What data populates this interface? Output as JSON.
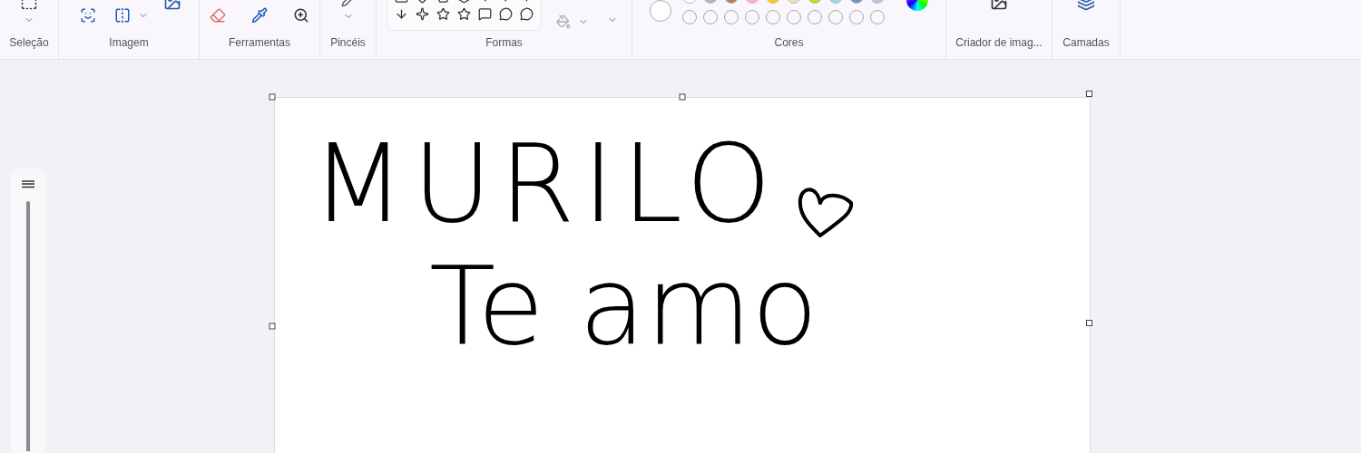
{
  "ribbon": {
    "groups": [
      {
        "kind": "selection",
        "label": "Seleção"
      },
      {
        "kind": "image",
        "label": "Imagem"
      },
      {
        "kind": "tools",
        "label": "Ferramentas"
      },
      {
        "kind": "brushes",
        "label": "Pincéis"
      },
      {
        "kind": "shapes",
        "label": "Formas"
      },
      {
        "kind": "colors",
        "label": "Cores"
      },
      {
        "kind": "creator",
        "label": "Criador de imag..."
      },
      {
        "kind": "layers",
        "label": "Camadas"
      }
    ]
  },
  "colors": {
    "primary": {
      "color": "#ffffff"
    },
    "palette": [
      {
        "color": "#ffffff"
      },
      {
        "color": "#b4b4b4"
      },
      {
        "color": "#b97a57"
      },
      {
        "color": "#ffaec9"
      },
      {
        "color": "#ffc90e"
      },
      {
        "color": "#efe4b0"
      },
      {
        "color": "#b5e61d"
      },
      {
        "color": "#99d9ea"
      },
      {
        "color": "#7092be"
      },
      {
        "color": "#c8bfe7"
      }
    ]
  },
  "brush_size": {
    "level": 0
  },
  "canvas": {
    "lines": [
      "MURILO",
      "Te amo"
    ]
  }
}
